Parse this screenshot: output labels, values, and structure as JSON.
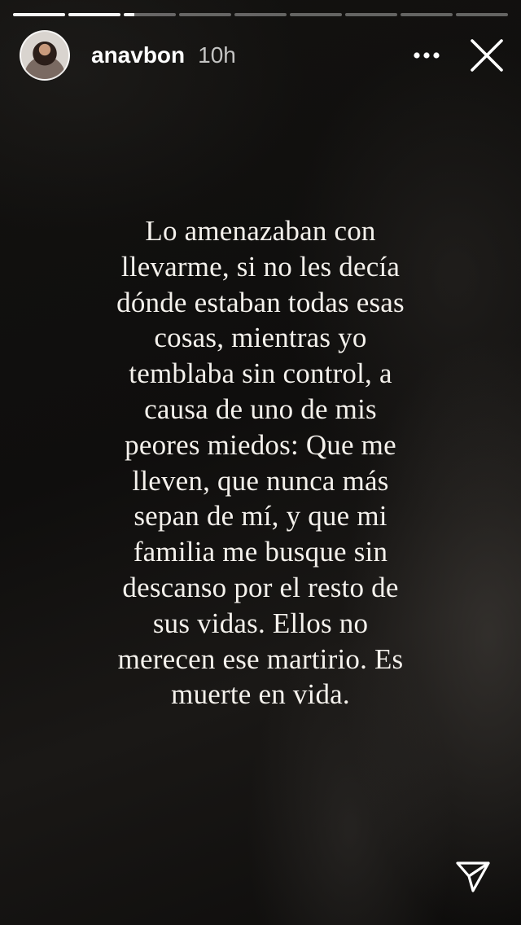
{
  "story": {
    "progress": [
      {
        "fill": 1.0
      },
      {
        "fill": 1.0
      },
      {
        "fill": 0.2
      },
      {
        "fill": 0.0
      },
      {
        "fill": 0.0
      },
      {
        "fill": 0.0
      },
      {
        "fill": 0.0
      },
      {
        "fill": 0.0
      },
      {
        "fill": 0.0
      }
    ],
    "current_segment": 3,
    "total_segments": 9
  },
  "header": {
    "username": "anavbon",
    "timestamp": "10h",
    "avatar_icon": "profile-avatar",
    "more_icon": "more-horizontal-icon",
    "close_icon": "close-icon"
  },
  "content": {
    "text": "Lo amenazaban con\nllevarme, si no les decía\ndónde estaban todas esas\ncosas, mientras yo\ntemblaba sin control, a\ncausa de uno de mis\npeores miedos: Que me\nlleven, que nunca más\nsepan de mí, y que mi\nfamilia me busque sin\ndescanso por el resto de\nsus vidas. Ellos no\nmerecen ese martirio. Es\nmuerte en vida."
  },
  "footer": {
    "share_icon": "send-icon"
  },
  "colors": {
    "text": "#f4f1ec",
    "progress_active": "#ffffff",
    "progress_inactive": "rgba(255,255,255,0.35)"
  }
}
